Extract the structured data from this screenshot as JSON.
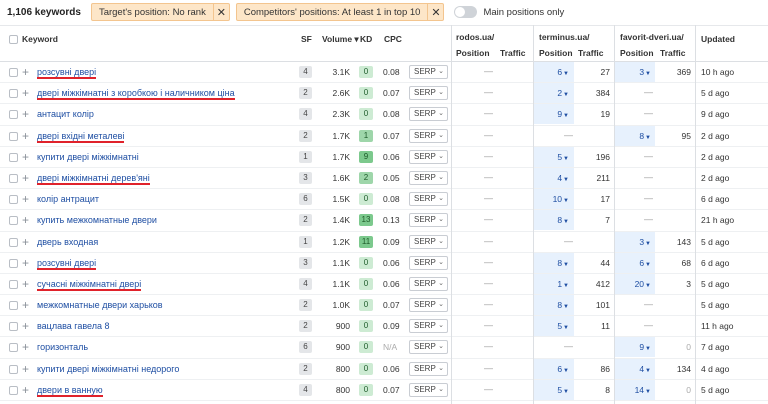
{
  "topbar": {
    "count": "1,106 keywords",
    "filters": [
      {
        "label": "Target's position: No rank"
      },
      {
        "label": "Competitors' positions: At least 1 in top 10"
      }
    ],
    "toggle_label": "Main positions only"
  },
  "header": {
    "keyword": "Keyword",
    "sf": "SF",
    "volume": "Volume ▾",
    "kd": "KD",
    "cpc": "CPC",
    "sites": [
      {
        "name": "rodos.ua/",
        "position": "Position",
        "traffic": "Traffic"
      },
      {
        "name": "terminus.ua/",
        "position": "Position",
        "traffic": "Traffic"
      },
      {
        "name": "favorit-dveri.ua/",
        "position": "Position",
        "traffic": "Traffic"
      }
    ],
    "updated": "Updated"
  },
  "serp_label": "SERP",
  "rows": [
    {
      "kw": "розсувні двері",
      "ul": true,
      "sf": "4",
      "vol": "3.1K",
      "kd": "0",
      "kdc": "#cdebd3",
      "cpc": "0.08",
      "r": "—",
      "t1": "6",
      "t1h": true,
      "tr1": "27",
      "f": "3",
      "fh": true,
      "trf": "369",
      "upd": "10 h ago"
    },
    {
      "kw": "двері міжкімнатні з коробкою і наличником ціна",
      "ul": true,
      "sf": "2",
      "vol": "2.6K",
      "kd": "0",
      "kdc": "#cdebd3",
      "cpc": "0.07",
      "r": "—",
      "t1": "2",
      "t1h": true,
      "tr1": "384",
      "f": "—",
      "fh": false,
      "trf": "",
      "upd": "5 d ago"
    },
    {
      "kw": "антацит колір",
      "ul": false,
      "sf": "4",
      "vol": "2.3K",
      "kd": "0",
      "kdc": "#cdebd3",
      "cpc": "0.08",
      "r": "—",
      "t1": "9",
      "t1h": true,
      "tr1": "19",
      "f": "—",
      "fh": false,
      "trf": "",
      "upd": "9 d ago"
    },
    {
      "kw": "двері вхідні металеві",
      "ul": true,
      "sf": "2",
      "vol": "1.7K",
      "kd": "1",
      "kdc": "#9ed6aa",
      "cpc": "0.07",
      "r": "—",
      "t1": "—",
      "t1h": false,
      "tr1": "",
      "f": "8",
      "fh": true,
      "trf": "95",
      "upd": "2 d ago"
    },
    {
      "kw": "купити двері міжкімнатні",
      "ul": false,
      "sf": "1",
      "vol": "1.7K",
      "kd": "9",
      "kdc": "#7cc98d",
      "cpc": "0.06",
      "r": "—",
      "t1": "5",
      "t1h": true,
      "tr1": "196",
      "f": "—",
      "fh": false,
      "trf": "",
      "upd": "2 d ago"
    },
    {
      "kw": "двері міжкімнатні дерев'яні",
      "ul": true,
      "sf": "3",
      "vol": "1.6K",
      "kd": "2",
      "kdc": "#9ed6aa",
      "cpc": "0.05",
      "r": "—",
      "t1": "4",
      "t1h": true,
      "tr1": "211",
      "f": "—",
      "fh": false,
      "trf": "",
      "upd": "2 d ago"
    },
    {
      "kw": "колір антрацит",
      "ul": false,
      "sf": "6",
      "vol": "1.5K",
      "kd": "0",
      "kdc": "#cdebd3",
      "cpc": "0.08",
      "r": "—",
      "t1": "10",
      "t1h": true,
      "tr1": "17",
      "f": "—",
      "fh": false,
      "trf": "",
      "upd": "6 d ago"
    },
    {
      "kw": "купить межкомнатные двери",
      "ul": false,
      "sf": "2",
      "vol": "1.4K",
      "kd": "13",
      "kdc": "#7cc98d",
      "cpc": "0.13",
      "r": "—",
      "t1": "8",
      "t1h": true,
      "tr1": "7",
      "f": "—",
      "fh": false,
      "trf": "",
      "upd": "21 h ago"
    },
    {
      "kw": "дверь входная",
      "ul": false,
      "sf": "1",
      "vol": "1.2K",
      "kd": "11",
      "kdc": "#7cc98d",
      "cpc": "0.09",
      "r": "—",
      "t1": "—",
      "t1h": false,
      "tr1": "",
      "f": "3",
      "fh": true,
      "trf": "143",
      "upd": "5 d ago"
    },
    {
      "kw": "розсувні двері",
      "ul": true,
      "sf": "3",
      "vol": "1.1K",
      "kd": "0",
      "kdc": "#cdebd3",
      "cpc": "0.06",
      "r": "—",
      "t1": "8",
      "t1h": true,
      "tr1": "44",
      "f": "6",
      "fh": true,
      "trf": "68",
      "upd": "6 d ago"
    },
    {
      "kw": "сучасні міжкімнатні двері",
      "ul": true,
      "sf": "4",
      "vol": "1.1K",
      "kd": "0",
      "kdc": "#cdebd3",
      "cpc": "0.06",
      "r": "—",
      "t1": "1",
      "t1h": true,
      "tr1": "412",
      "f": "20",
      "fh": true,
      "trf": "3",
      "upd": "5 d ago"
    },
    {
      "kw": "межкомнатные двери харьков",
      "ul": false,
      "sf": "2",
      "vol": "1.0K",
      "kd": "0",
      "kdc": "#cdebd3",
      "cpc": "0.07",
      "r": "—",
      "t1": "8",
      "t1h": true,
      "tr1": "101",
      "f": "—",
      "fh": false,
      "trf": "",
      "upd": "5 d ago"
    },
    {
      "kw": "вацлава гавела 8",
      "ul": false,
      "sf": "2",
      "vol": "900",
      "kd": "0",
      "kdc": "#cdebd3",
      "cpc": "0.09",
      "r": "—",
      "t1": "5",
      "t1h": true,
      "tr1": "11",
      "f": "—",
      "fh": false,
      "trf": "",
      "upd": "11 h ago"
    },
    {
      "kw": "горизонталь",
      "ul": false,
      "sf": "6",
      "vol": "900",
      "kd": "0",
      "kdc": "#cdebd3",
      "cpc": "N/A",
      "r": "—",
      "t1": "—",
      "t1h": false,
      "tr1": "",
      "f": "9",
      "fh": true,
      "trf": "0",
      "upd": "7 d ago"
    },
    {
      "kw": "купити двері міжкімнатні недорого",
      "ul": false,
      "sf": "2",
      "vol": "800",
      "kd": "0",
      "kdc": "#cdebd3",
      "cpc": "0.06",
      "r": "—",
      "t1": "6",
      "t1h": true,
      "tr1": "86",
      "f": "4",
      "fh": true,
      "trf": "134",
      "upd": "4 d ago"
    },
    {
      "kw": "двери в ванную",
      "ul": true,
      "sf": "4",
      "vol": "800",
      "kd": "0",
      "kdc": "#cdebd3",
      "cpc": "0.07",
      "r": "—",
      "t1": "5",
      "t1h": true,
      "tr1": "8",
      "f": "14",
      "fh": true,
      "trf": "0",
      "upd": "5 d ago"
    }
  ]
}
